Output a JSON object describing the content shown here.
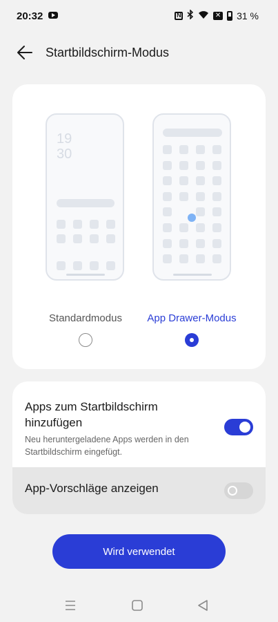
{
  "status_bar": {
    "time": "20:32",
    "battery_text": "31 %",
    "icons": [
      "youtube-icon",
      "nfc-icon",
      "bluetooth-icon",
      "wifi-icon",
      "sim-off-icon",
      "battery-icon"
    ]
  },
  "header": {
    "title": "Startbildschirm-Modus",
    "back_icon": "arrow-left-icon"
  },
  "mode_card": {
    "standard": {
      "label": "Standardmodus",
      "selected": false,
      "clock_hour": "19",
      "clock_minute": "30"
    },
    "drawer": {
      "label": "App Drawer-Modus",
      "selected": true
    }
  },
  "settings": {
    "add_apps": {
      "title": "Apps zum Startbildschirm hinzufügen",
      "subtitle": "Neu heruntergeladene Apps werden in den Startbildschirm eingefügt.",
      "enabled": true
    },
    "suggestions": {
      "title": "App-Vorschläge anzeigen",
      "enabled": false
    }
  },
  "primary_button": {
    "label": "Wird verwendet"
  },
  "nav_bar": {
    "icons": [
      "menu-icon",
      "home-icon",
      "back-icon"
    ]
  },
  "colors": {
    "accent": "#2a3dd6",
    "background": "#f2f2f2",
    "card": "#ffffff"
  }
}
